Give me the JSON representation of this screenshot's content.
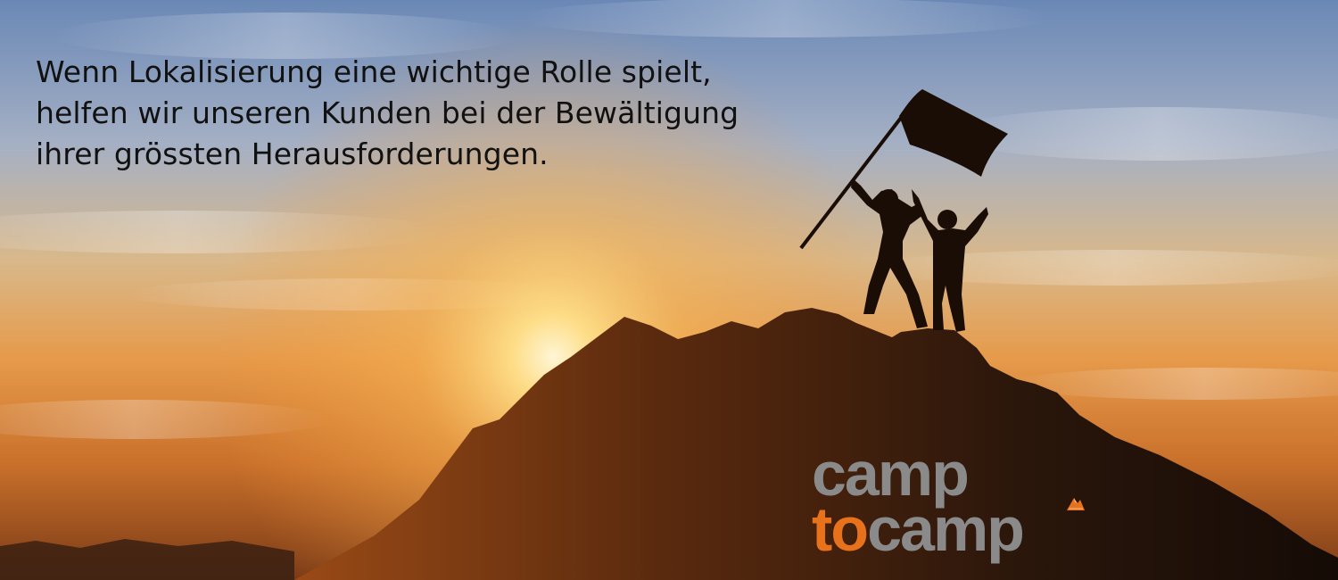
{
  "banner": {
    "headline_lines": [
      "Wenn Lokalisierung eine wichtige Rolle spielt,",
      "helfen wir unseren Kunden bei der Bewältigung",
      "ihrer grössten Herausforderungen."
    ]
  },
  "logo": {
    "line1": "camp",
    "line2_accent": "to",
    "line2_rest": "camp",
    "icon": "mountain-peak-icon"
  },
  "colors": {
    "headline_text": "#111111",
    "logo_grey": "#8a8a8a",
    "logo_orange": "#e8711c",
    "sky_top": "#6f8fb8",
    "sun_glow": "#ffd27a",
    "silhouette": "#1c0f08"
  }
}
